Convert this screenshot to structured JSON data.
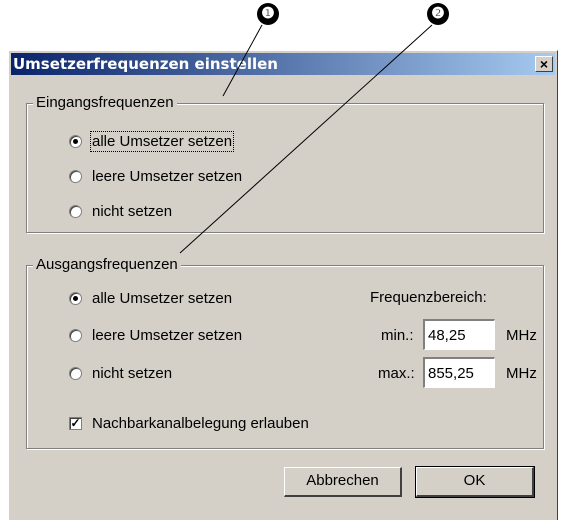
{
  "callouts": [
    "❶",
    "❷"
  ],
  "dialog": {
    "title": "Umsetzerfrequenzen einstellen",
    "close_label": "×"
  },
  "input_group": {
    "legend": "Eingangsfrequenzen",
    "options": [
      "alle Umsetzer setzen",
      "leere Umsetzer setzen",
      "nicht setzen"
    ],
    "selected": 0
  },
  "output_group": {
    "legend": "Ausgangsfrequenzen",
    "options": [
      "alle Umsetzer setzen",
      "leere Umsetzer setzen",
      "nicht setzen"
    ],
    "selected": 0,
    "range_label": "Frequenzbereich:",
    "min_label": "min.:",
    "min_value": "48,25",
    "max_label": "max.:",
    "max_value": "855,25",
    "unit": "MHz",
    "neighbor_checkbox_label": "Nachbarkanalbelegung erlauben",
    "neighbor_checked": true
  },
  "buttons": {
    "cancel": "Abbrechen",
    "ok": "OK"
  },
  "colors": {
    "titlebar_start": "#0a246a",
    "titlebar_end": "#a6caf0",
    "dialog_bg": "#d4d0c8"
  }
}
